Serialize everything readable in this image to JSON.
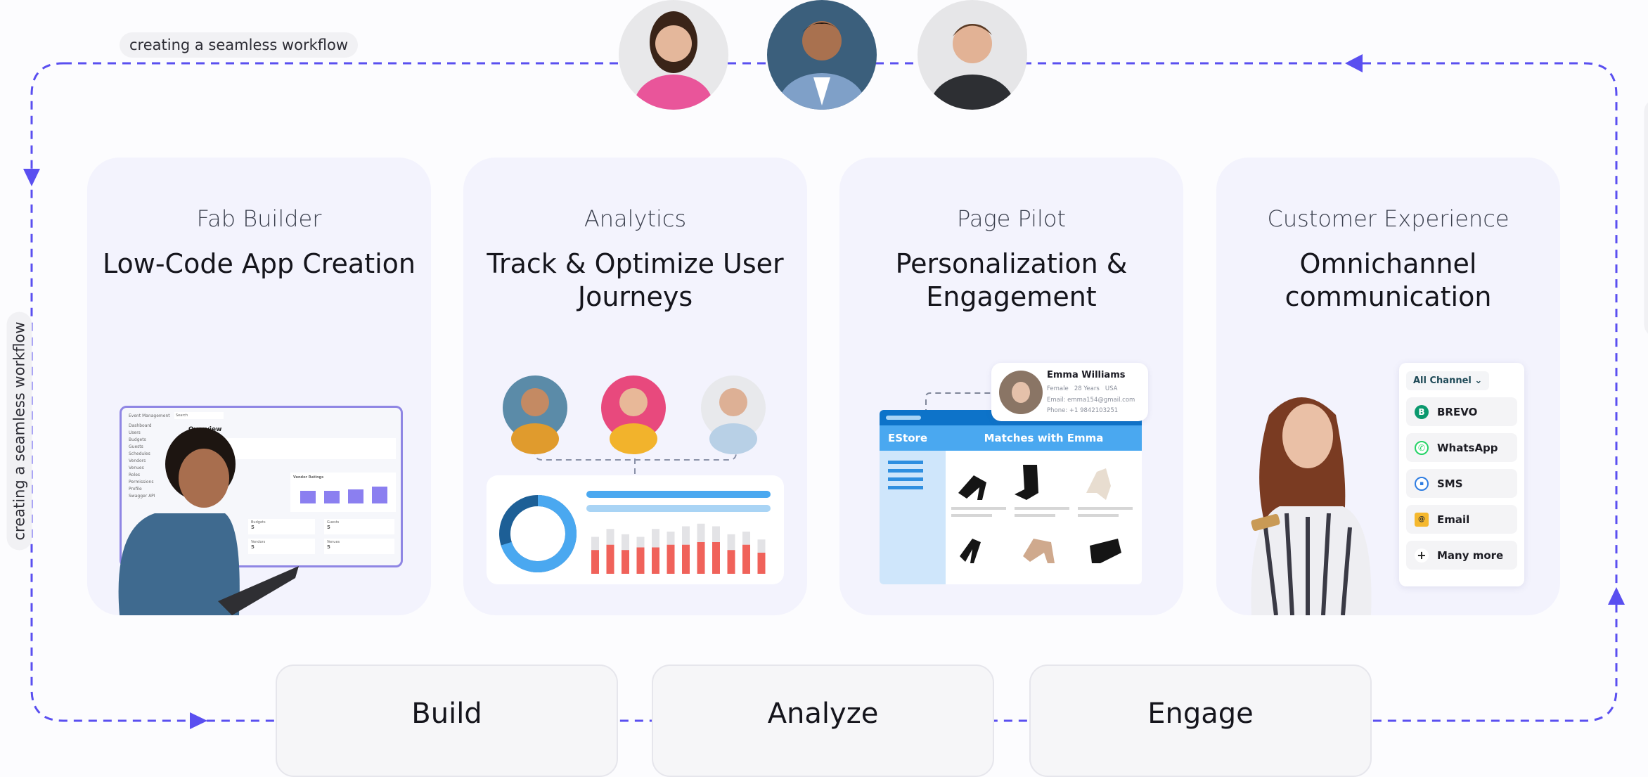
{
  "flow_label": "creating a seamless workflow",
  "flow_color": "#5a4ff0",
  "cards": [
    {
      "product": "Fab Builder",
      "title": "Low-Code App Creation"
    },
    {
      "product": "Analytics",
      "title": "Track & Optimize User Journeys"
    },
    {
      "product": "Page Pilot",
      "title": "Personalization & Engagement"
    },
    {
      "product": "Customer Experience",
      "title": "Omnichannel communication"
    }
  ],
  "steps": [
    "Build",
    "Analyze",
    "Engage"
  ],
  "dashboard": {
    "app_name": "Event Management",
    "search_placeholder": "Search",
    "heading": "Overview",
    "nav": [
      "Dashboard",
      "Users",
      "Budgets",
      "Guests",
      "Schedules",
      "Vendors",
      "Venues",
      "Roles",
      "Permissions",
      "Profile",
      "Swagger API"
    ],
    "chart_title": "Vendor Ratings",
    "stats": [
      {
        "label": "Budgets",
        "value": "5"
      },
      {
        "label": "Guests",
        "value": "5"
      },
      {
        "label": "Vendors",
        "value": "5"
      },
      {
        "label": "Venues",
        "value": "5"
      }
    ]
  },
  "analytics": {
    "donut_fill_pct": 70,
    "bars": [
      {
        "total": 70,
        "red": 45
      },
      {
        "total": 85,
        "red": 55
      },
      {
        "total": 75,
        "red": 45
      },
      {
        "total": 70,
        "red": 50
      },
      {
        "total": 85,
        "red": 50
      },
      {
        "total": 80,
        "red": 55
      },
      {
        "total": 90,
        "red": 55
      },
      {
        "total": 95,
        "red": 60
      },
      {
        "total": 90,
        "red": 60
      },
      {
        "total": 75,
        "red": 45
      },
      {
        "total": 80,
        "red": 55
      },
      {
        "total": 65,
        "red": 40
      }
    ]
  },
  "profile": {
    "name": "Emma Williams",
    "gender": "Female",
    "age": "28 Years",
    "country": "USA",
    "email": "Email: emma154@gmail.com",
    "phone": "Phone: +1 9842103251"
  },
  "estore": {
    "brand": "EStore",
    "heading": "Matches with Emma"
  },
  "channels": {
    "filter": "All Channel",
    "items": [
      {
        "label": "BREVO",
        "icon": "brevo-icon",
        "color": "#0b996e"
      },
      {
        "label": "WhatsApp",
        "icon": "whatsapp-icon",
        "color": "#25d366"
      },
      {
        "label": "SMS",
        "icon": "sms-icon",
        "color": "#2f7de1"
      },
      {
        "label": "Email",
        "icon": "email-icon",
        "color": "#f5b82e"
      },
      {
        "label": "Many more",
        "icon": "plus-icon",
        "color": "#ffffff"
      }
    ]
  }
}
